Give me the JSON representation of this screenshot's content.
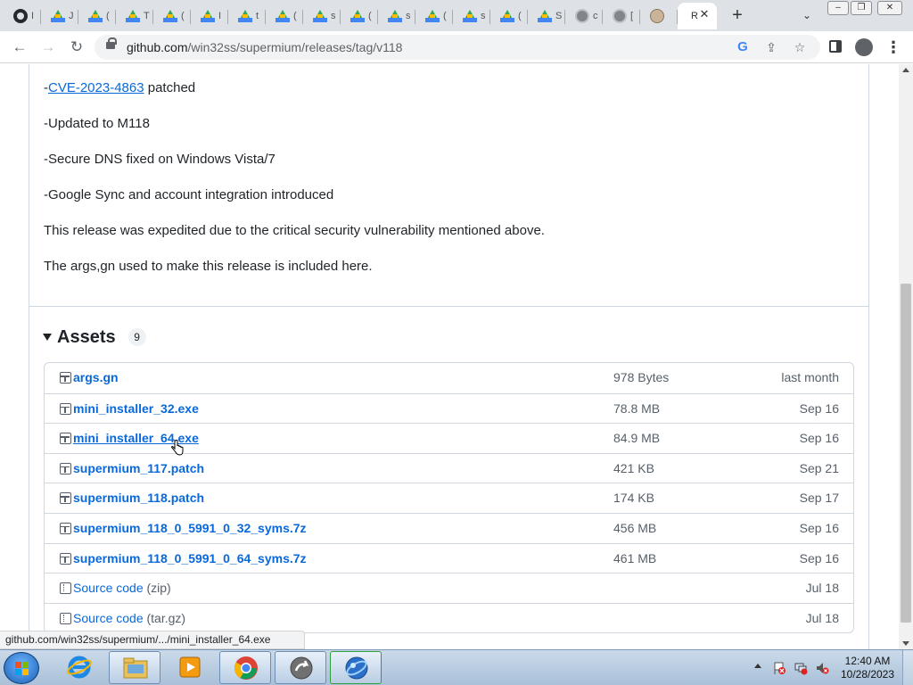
{
  "browser": {
    "tabs": [
      {
        "favicon": "github-icon",
        "title": "I"
      },
      {
        "favicon": "drive-icon",
        "title": "J"
      },
      {
        "favicon": "drive-icon",
        "title": "("
      },
      {
        "favicon": "drive-icon",
        "title": "T"
      },
      {
        "favicon": "drive-icon",
        "title": "("
      },
      {
        "favicon": "drive-icon",
        "title": "I"
      },
      {
        "favicon": "drive-icon",
        "title": "t"
      },
      {
        "favicon": "drive-icon",
        "title": "("
      },
      {
        "favicon": "drive-icon",
        "title": "s"
      },
      {
        "favicon": "drive-icon",
        "title": "("
      },
      {
        "favicon": "drive-icon",
        "title": "s"
      },
      {
        "favicon": "drive-icon",
        "title": "("
      },
      {
        "favicon": "drive-icon",
        "title": "s"
      },
      {
        "favicon": "drive-icon",
        "title": "("
      },
      {
        "favicon": "drive-icon",
        "title": "S"
      },
      {
        "favicon": "globe-icon",
        "title": "c"
      },
      {
        "favicon": "globe-icon",
        "title": "["
      },
      {
        "favicon": "cat-icon",
        "title": ""
      },
      {
        "favicon": "",
        "title": "R",
        "active": true
      }
    ],
    "url_host": "github.com",
    "url_path": "/win32ss/supermium/releases/tag/v118",
    "status_url": "github.com/win32ss/supermium/.../mini_installer_64.exe"
  },
  "release_notes": {
    "cve_prefix": "-",
    "cve_link": "CVE-2023-4863",
    "cve_suffix": " patched",
    "line2": "-Updated to M118",
    "line3": "-Secure DNS fixed on Windows Vista/7",
    "line4": "-Google Sync and account integration introduced",
    "line5": "This release was expedited due to the critical security vulnerability mentioned above.",
    "line6": "The args,gn used to make this release is included here."
  },
  "assets": {
    "title": "Assets",
    "count": "9",
    "items": [
      {
        "name": "args.gn",
        "size": "978 Bytes",
        "date": "last month",
        "icon": "package-icon"
      },
      {
        "name": "mini_installer_32.exe",
        "size": "78.8 MB",
        "date": "Sep 16",
        "icon": "package-icon"
      },
      {
        "name": "mini_installer_64.exe",
        "size": "84.9 MB",
        "date": "Sep 16",
        "icon": "package-icon"
      },
      {
        "name": "supermium_117.patch",
        "size": "421 KB",
        "date": "Sep 21",
        "icon": "package-icon"
      },
      {
        "name": "supermium_118.patch",
        "size": "174 KB",
        "date": "Sep 17",
        "icon": "package-icon"
      },
      {
        "name": "supermium_118_0_5991_0_32_syms.7z",
        "size": "456 MB",
        "date": "Sep 16",
        "icon": "package-icon"
      },
      {
        "name": "supermium_118_0_5991_0_64_syms.7z",
        "size": "461 MB",
        "date": "Sep 16",
        "icon": "package-icon"
      },
      {
        "name": "Source code",
        "suffix": " (zip)",
        "size": "",
        "date": "Jul 18",
        "icon": "file-zip-icon"
      },
      {
        "name": "Source code",
        "suffix": " (tar.gz)",
        "size": "",
        "date": "Jul 18",
        "icon": "file-zip-icon"
      }
    ]
  },
  "taskbar": {
    "time": "12:40 AM",
    "date": "10/28/2023"
  },
  "colors": {
    "link": "#0969da",
    "text": "#1f2328",
    "muted": "#57606a",
    "border": "#d0d7de"
  }
}
